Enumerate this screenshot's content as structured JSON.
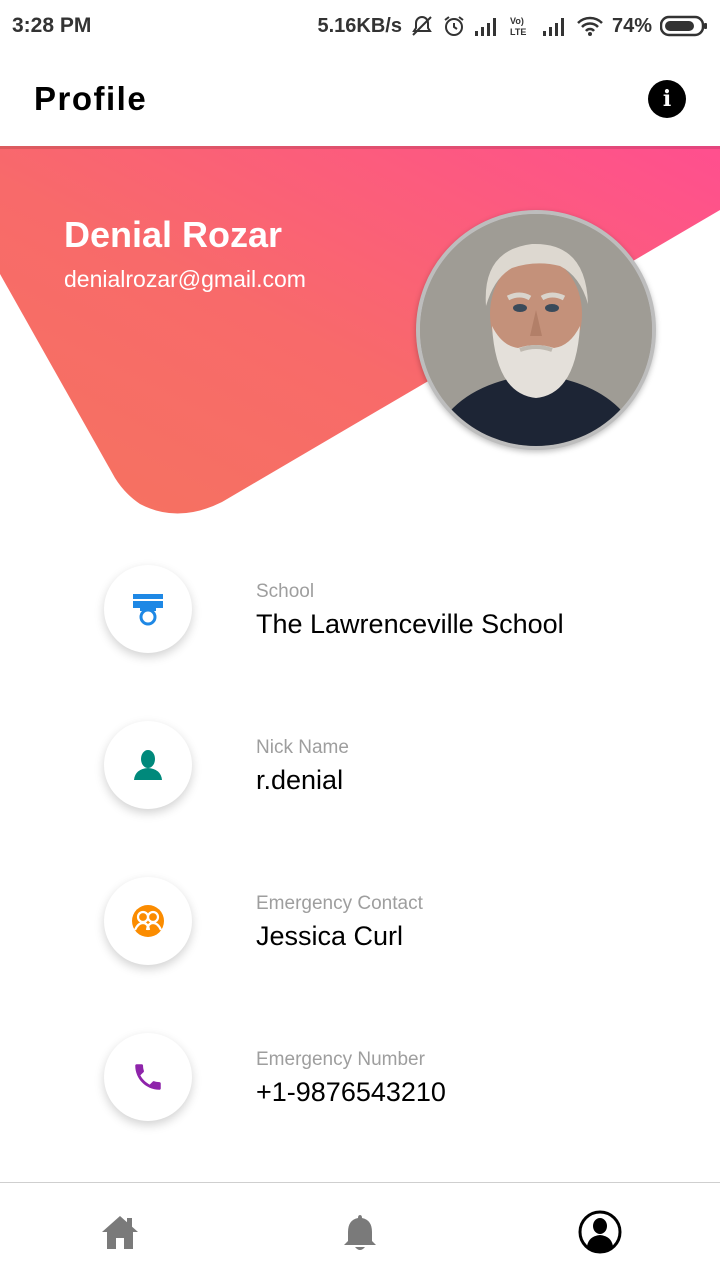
{
  "status_bar": {
    "time": "3:28 PM",
    "speed": "5.16KB/s",
    "battery": "74%",
    "icons": [
      "mute-icon",
      "alarm-icon",
      "signal-icon",
      "volte-icon",
      "signal-icon",
      "wifi-icon",
      "battery-icon"
    ]
  },
  "header": {
    "title": "Profile",
    "info_icon": "info-icon"
  },
  "profile": {
    "name": "Denial Rozar",
    "email": "denialrozar@gmail.com",
    "gradient_start": "#f5735f",
    "gradient_end": "#ff4f8f"
  },
  "fields": [
    {
      "label": "School",
      "value": "The Lawrenceville School",
      "icon": "school-icon",
      "color": "#1e88e5"
    },
    {
      "label": "Nick Name",
      "value": "r.denial",
      "icon": "person-icon",
      "color": "#00897b"
    },
    {
      "label": "Emergency Contact",
      "value": "Jessica Curl",
      "icon": "group-icon",
      "color": "#fb8c00"
    },
    {
      "label": "Emergency Number",
      "value": "+1-9876543210",
      "icon": "phone-icon",
      "color": "#8e24aa"
    }
  ],
  "bottom_nav": {
    "items": [
      "home-icon",
      "bell-icon",
      "account-icon"
    ],
    "active": "account-icon"
  }
}
